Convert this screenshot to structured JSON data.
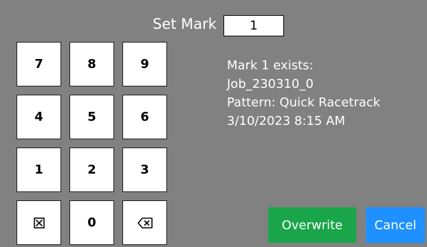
{
  "title": "Set Mark",
  "mark_value": "1",
  "keypad": {
    "rows": [
      [
        "7",
        "8",
        "9"
      ],
      [
        "4",
        "5",
        "6"
      ],
      [
        "1",
        "2",
        "3"
      ]
    ],
    "zero": "0",
    "clear_icon": "clear-box-icon",
    "backspace_icon": "backspace-icon"
  },
  "info": {
    "line1": "Mark 1 exists:",
    "line2": "Job_230310_0",
    "line3": "Pattern: Quick Racetrack",
    "line4": "3/10/2023 8:15 AM"
  },
  "buttons": {
    "overwrite": "Overwrite",
    "cancel": "Cancel"
  },
  "colors": {
    "background": "#818181",
    "overwrite": "#1aa54a",
    "cancel": "#1e90ff"
  }
}
